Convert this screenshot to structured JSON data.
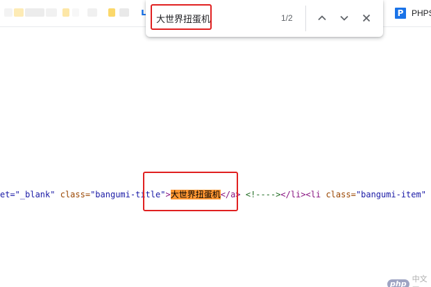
{
  "bookmarks_bar": {
    "php_bookmark_label": "PHPS",
    "php_icon_letter": "P"
  },
  "find_bar": {
    "query": "大世界扭蛋机",
    "match_count": "1/2",
    "icons": [
      "chevron-up-icon",
      "chevron-down-icon",
      "close-icon"
    ]
  },
  "source_line": {
    "tokens": [
      {
        "text": "et=\"_blank\"",
        "type": "attr-val"
      },
      {
        "text": " ",
        "type": "plain"
      },
      {
        "text": "class=",
        "type": "attr-name"
      },
      {
        "text": "\"bangumi-title\"",
        "type": "attr-val"
      },
      {
        "text": ">",
        "type": "tag"
      },
      {
        "text": "大世界扭蛋机",
        "type": "match"
      },
      {
        "text": "</a>",
        "type": "tag"
      },
      {
        "text": " ",
        "type": "plain"
      },
      {
        "text": "<!---->",
        "type": "comment"
      },
      {
        "text": "</li>",
        "type": "tag"
      },
      {
        "text": "<li ",
        "type": "tag"
      },
      {
        "text": "class=",
        "type": "attr-name"
      },
      {
        "text": "\"bangumi-item\"",
        "type": "attr-val"
      },
      {
        "text": " s",
        "type": "attr-name"
      }
    ]
  },
  "watermark": {
    "logo_text": "php",
    "site_text": "中文网"
  },
  "colors": {
    "match_highlight": "#ff9632",
    "annotation_red": "#e02020",
    "accent_blue": "#1a73e8"
  }
}
